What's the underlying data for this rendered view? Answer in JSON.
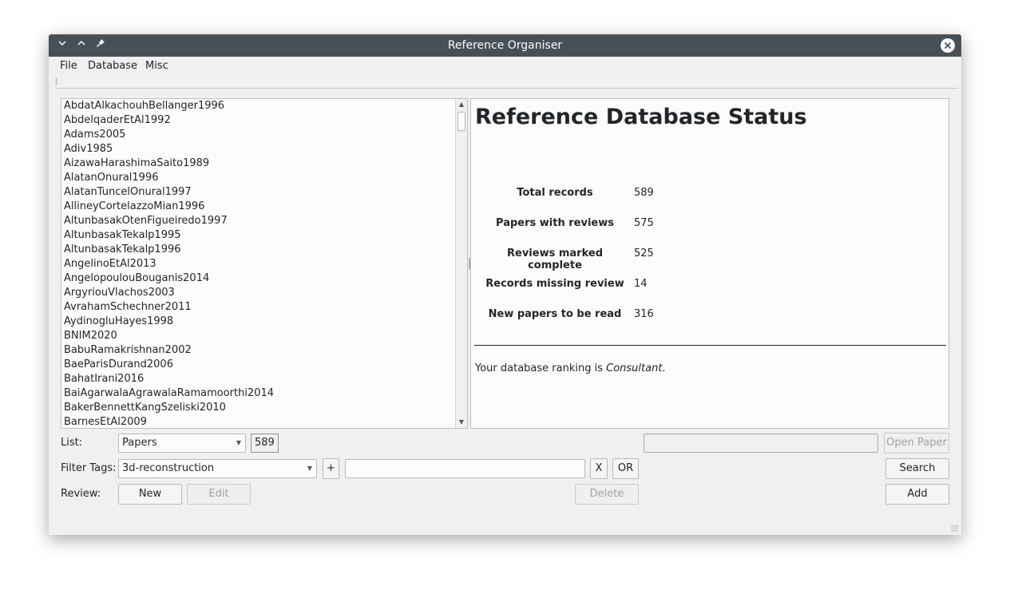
{
  "window": {
    "title": "Reference Organiser",
    "icons": {
      "minimize": "chevron-down-icon",
      "maximize": "chevron-up-icon",
      "pin": "pin-icon",
      "close": "close-icon"
    }
  },
  "menu": {
    "file": "File",
    "database": "Database",
    "misc": "Misc"
  },
  "papers": [
    "AbdatAlkachouhBellanger1996",
    "AbdelqaderEtAl1992",
    "Adams2005",
    "Adiv1985",
    "AizawaHarashimaSaito1989",
    "AlatanOnural1996",
    "AlatanTuncelOnural1997",
    "AllineyCortelazzoMian1996",
    "AltunbasakOtenFigueiredo1997",
    "AltunbasakTekalp1995",
    "AltunbasakTekalp1996",
    "AngelinoEtAl2013",
    "AngelopoulouBouganis2014",
    "ArgyriouVlachos2003",
    "AvrahamSchechner2011",
    "AydinogluHayes1998",
    "BNIM2020",
    "BabuRamakrishnan2002",
    "BaeParisDurand2006",
    "BahatIrani2016",
    "BaiAgarwalaAgrawalaRamamoorthi2014",
    "BakerBennettKangSzeliski2010",
    "BarnesEtAl2009"
  ],
  "status": {
    "heading": "Reference Database Status",
    "stats": [
      {
        "label": "Total records",
        "value": "589"
      },
      {
        "label": "Papers with reviews",
        "value": "575"
      },
      {
        "label": "Reviews marked complete",
        "value": "525"
      },
      {
        "label": "Records missing review",
        "value": "14"
      },
      {
        "label": "New papers to be read",
        "value": "316"
      }
    ],
    "ranking_prefix": "Your database ranking is ",
    "ranking_value": "Consultant",
    "ranking_suffix": "."
  },
  "controls": {
    "list_label": "List:",
    "list_value": "Papers",
    "list_count": "589",
    "filter_label": "Filter Tags:",
    "filter_value": "3d-reconstruction",
    "plus": "+",
    "x": "X",
    "or": "OR",
    "review_label": "Review:",
    "new": "New",
    "edit": "Edit",
    "delete": "Delete",
    "open_paper": "Open Paper",
    "search": "Search",
    "add": "Add"
  }
}
